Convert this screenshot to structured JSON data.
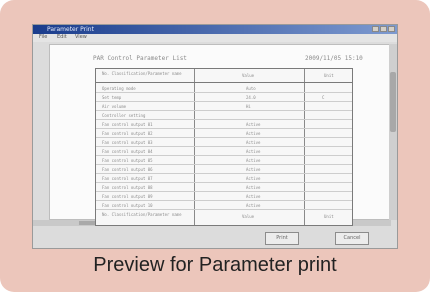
{
  "window": {
    "title": "Parameter Print",
    "menu": [
      "File",
      "Edit",
      "View"
    ]
  },
  "document": {
    "title": "PAR Control Parameter List",
    "date": "2009/11/05 15:10",
    "table": {
      "headers": [
        "No. Classification/Parameter name",
        "Value",
        "Unit"
      ],
      "rows": [
        [
          "Operating mode",
          "Auto",
          ""
        ],
        [
          "Set temp",
          "24.0",
          "C"
        ],
        [
          "Air volume",
          "Hi",
          ""
        ],
        [
          "Controller setting",
          "",
          ""
        ],
        [
          "Fan control output 01",
          "Active",
          ""
        ],
        [
          "Fan control output 02",
          "Active",
          ""
        ],
        [
          "Fan control output 03",
          "Active",
          ""
        ],
        [
          "Fan control output 04",
          "Active",
          ""
        ],
        [
          "Fan control output 05",
          "Active",
          ""
        ],
        [
          "Fan control output 06",
          "Active",
          ""
        ],
        [
          "Fan control output 07",
          "Active",
          ""
        ],
        [
          "Fan control output 08",
          "Active",
          ""
        ],
        [
          "Fan control output 09",
          "Active",
          ""
        ],
        [
          "Fan control output 10",
          "Active",
          ""
        ]
      ],
      "footer": [
        "No. Classification/Parameter name",
        "Value",
        "Unit"
      ]
    }
  },
  "buttons": {
    "print": "Print",
    "cancel": "Cancel"
  },
  "caption": "Preview for Parameter print"
}
